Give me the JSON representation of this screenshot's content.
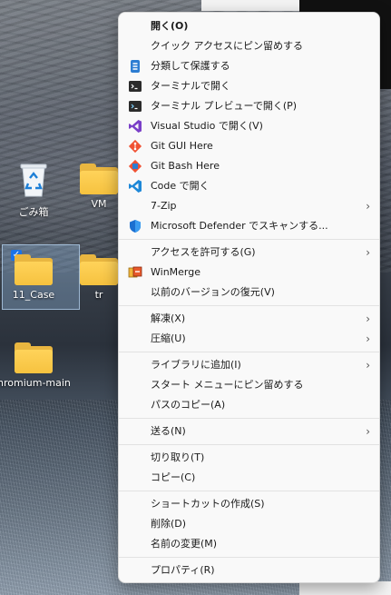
{
  "desktop": {
    "icons": [
      {
        "label": "ごみ箱",
        "icon": "recycle-bin-icon"
      },
      {
        "label": "VM",
        "icon": "folder-icon"
      },
      {
        "label": "11_Case",
        "icon": "folder-icon"
      },
      {
        "label": "tr",
        "icon": "folder-icon"
      },
      {
        "label": "hromium-main",
        "icon": "folder-icon"
      }
    ]
  },
  "menu": {
    "items": [
      {
        "label": "開く(O)",
        "icon": "",
        "bold": true
      },
      {
        "label": "クイック アクセスにピン留めする",
        "icon": ""
      },
      {
        "label": "分類して保護する",
        "icon": "protect-icon"
      },
      {
        "label": "ターミナルで開く",
        "icon": "terminal-icon"
      },
      {
        "label": "ターミナル プレビューで開く(P)",
        "icon": "terminal-preview-icon"
      },
      {
        "label": "Visual Studio で開く(V)",
        "icon": "visual-studio-icon"
      },
      {
        "label": "Git GUI Here",
        "icon": "git-gui-icon"
      },
      {
        "label": "Git Bash Here",
        "icon": "git-bash-icon"
      },
      {
        "label": "Code で開く",
        "icon": "vscode-icon"
      },
      {
        "label": "7-Zip",
        "icon": "",
        "submenu": true
      },
      {
        "label": "Microsoft Defender でスキャンする...",
        "icon": "defender-shield-icon"
      },
      {
        "sep": true
      },
      {
        "label": "アクセスを許可する(G)",
        "icon": "",
        "submenu": true
      },
      {
        "label": "WinMerge",
        "icon": "winmerge-icon"
      },
      {
        "label": "以前のバージョンの復元(V)",
        "icon": ""
      },
      {
        "sep": true
      },
      {
        "label": "解凍(X)",
        "icon": "",
        "submenu": true
      },
      {
        "label": "圧縮(U)",
        "icon": "",
        "submenu": true
      },
      {
        "sep": true
      },
      {
        "label": "ライブラリに追加(I)",
        "icon": "",
        "submenu": true
      },
      {
        "label": "スタート メニューにピン留めする",
        "icon": ""
      },
      {
        "label": "パスのコピー(A)",
        "icon": ""
      },
      {
        "sep": true
      },
      {
        "label": "送る(N)",
        "icon": "",
        "submenu": true
      },
      {
        "sep": true
      },
      {
        "label": "切り取り(T)",
        "icon": ""
      },
      {
        "label": "コピー(C)",
        "icon": ""
      },
      {
        "sep": true
      },
      {
        "label": "ショートカットの作成(S)",
        "icon": ""
      },
      {
        "label": "削除(D)",
        "icon": ""
      },
      {
        "label": "名前の変更(M)",
        "icon": ""
      },
      {
        "sep": true
      },
      {
        "label": "プロパティ(R)",
        "icon": ""
      }
    ]
  }
}
